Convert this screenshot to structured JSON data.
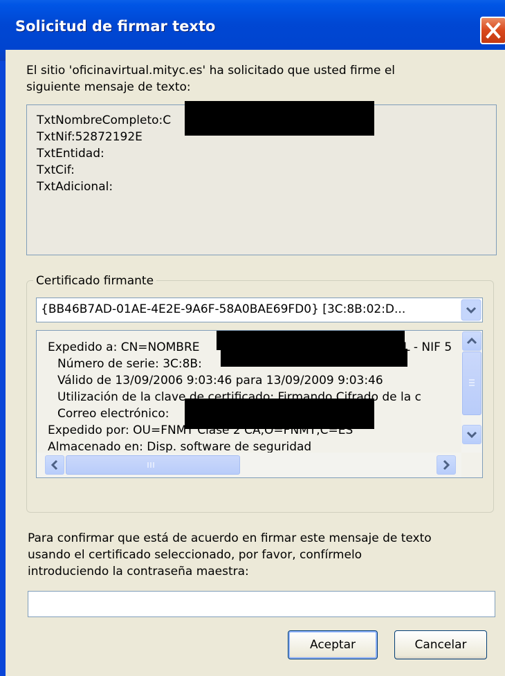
{
  "window": {
    "title": "Solicitud de firmar texto"
  },
  "intro_text_line1": "El sitio 'oficinavirtual.mityc.es' ha solicitado que usted firme el",
  "intro_text_line2": "siguiente mensaje de texto:",
  "message_lines": [
    "TxtNombreCompleto:C",
    "TxtNif:52872192E",
    "TxtEntidad:",
    "TxtCif:",
    "TxtAdicional:"
  ],
  "certificate_group": {
    "label": "Certificado firmante",
    "selected": "{BB46B7AD-01AE-4E2E-9A6F-58A0BAE69FD0} [3C:8B:02:D...",
    "details": [
      "Expedido a: CN=NOMBRE",
      "L - NIF 5",
      "Número de serie: 3C:8B:",
      "Válido de 13/09/2006 9:03:46 para 13/09/2009 9:03:46",
      "Utilización de la clave de certificado: Firmando,Cifrado de la c",
      "Correo electrónico:",
      "Expedido por: OU=FNMT Clase 2 CA,O=FNMT,C=ES",
      "Almacenado en: Disp. software de seguridad"
    ]
  },
  "confirm_text_line1": "Para confirmar que está de acuerdo en firmar este mensaje de texto",
  "confirm_text_line2": "usando el certificado seleccionado, por favor, confírmelo",
  "confirm_text_line3": "introduciendo la contraseña maestra:",
  "password_value": "",
  "buttons": {
    "accept": "Aceptar",
    "cancel": "Cancelar"
  },
  "colors": {
    "titlebar": "#0047d3",
    "dialog_bg": "#ece9d8",
    "close_button": "#d9481c"
  }
}
